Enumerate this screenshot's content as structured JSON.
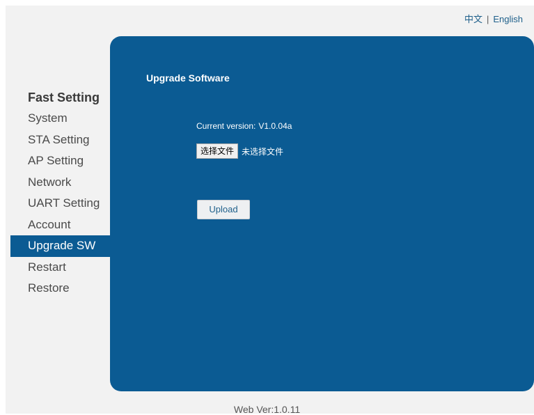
{
  "lang": {
    "chinese": "中文",
    "separator": "|",
    "english": "English"
  },
  "sidebar": {
    "header": "Fast Setting",
    "items": [
      {
        "label": "System"
      },
      {
        "label": "STA Setting"
      },
      {
        "label": "AP Setting"
      },
      {
        "label": "Network"
      },
      {
        "label": "UART Setting"
      },
      {
        "label": "Account"
      },
      {
        "label": "Upgrade SW",
        "active": true
      },
      {
        "label": "Restart"
      },
      {
        "label": "Restore"
      }
    ]
  },
  "panel": {
    "title": "Upgrade Software",
    "version_label": "Current version:",
    "version_value": "V1.0.04a",
    "file_button": "选择文件",
    "file_status": "未选择文件",
    "upload_button": "Upload"
  },
  "footer": {
    "web_version": "Web Ver:1.0.11"
  },
  "colors": {
    "accent": "#0b5b93",
    "link": "#1e5f8a"
  }
}
